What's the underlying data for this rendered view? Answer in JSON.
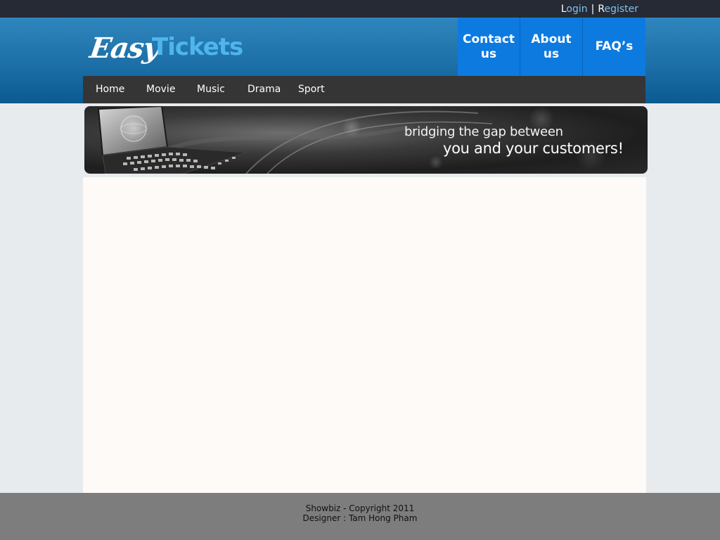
{
  "auth": {
    "login": {
      "first": "L",
      "rest": "ogin"
    },
    "separator": "|",
    "register": {
      "first": "R",
      "rest": "egister"
    }
  },
  "logo": {
    "part1": "Easy",
    "part2": "Tickets"
  },
  "top_links": [
    "Contact us",
    "About us",
    "FAQ’s"
  ],
  "nav": [
    "Home",
    "Movie",
    "Music",
    "Drama",
    "Sport"
  ],
  "banner": {
    "line1": "bridging the gap between",
    "line2": "you and your customers!"
  },
  "footer": {
    "line1": "Showbiz - Copyright 2011",
    "line2": "Designer : Tam Hong Pham"
  },
  "colors": {
    "top_bar": "#252a35",
    "header_blue": "#1c6fa7",
    "top_link_blue": "#0d7ae0",
    "nav_bg": "#353535",
    "footer_bg": "#7d7d7d"
  }
}
